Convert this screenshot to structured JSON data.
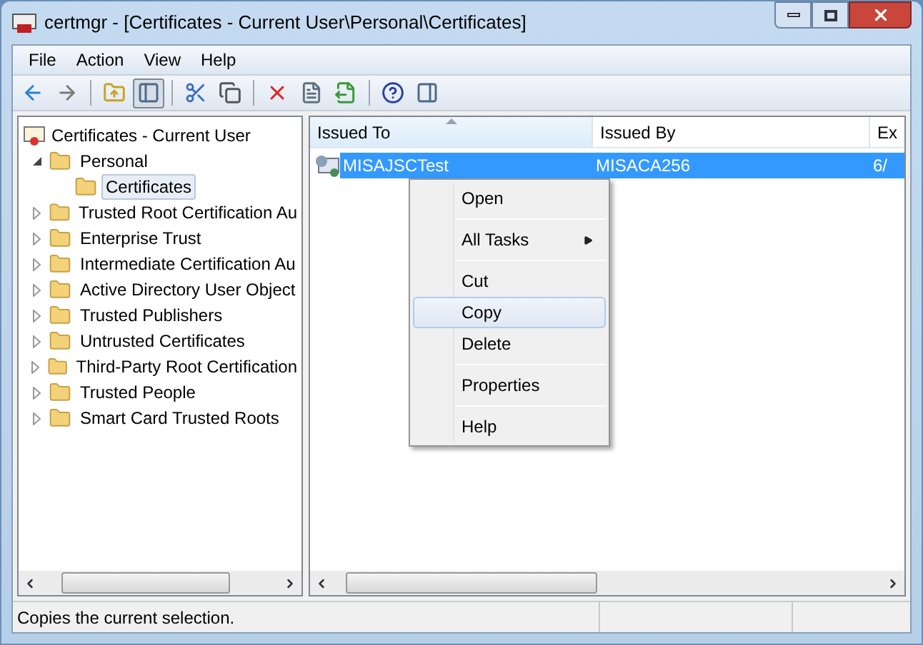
{
  "window": {
    "title": "certmgr - [Certificates - Current User\\Personal\\Certificates]"
  },
  "menu_bar": [
    "File",
    "Action",
    "View",
    "Help"
  ],
  "toolbar": [
    {
      "kind": "back",
      "pressed": false
    },
    {
      "kind": "forward",
      "pressed": false
    },
    {
      "kind": "separator"
    },
    {
      "kind": "up",
      "pressed": false
    },
    {
      "kind": "tree",
      "pressed": true
    },
    {
      "kind": "separator"
    },
    {
      "kind": "cut",
      "pressed": false
    },
    {
      "kind": "copy",
      "pressed": false
    },
    {
      "kind": "separator"
    },
    {
      "kind": "delete",
      "pressed": false
    },
    {
      "kind": "properties",
      "pressed": false
    },
    {
      "kind": "export",
      "pressed": false
    },
    {
      "kind": "separator"
    },
    {
      "kind": "help",
      "pressed": false
    },
    {
      "kind": "pane",
      "pressed": false
    }
  ],
  "tree": {
    "label": "Certificates - Current User",
    "children": [
      {
        "label": "Personal",
        "expanded": true,
        "selected": false,
        "children": [
          {
            "label": "Certificates",
            "selected": true
          }
        ]
      },
      {
        "label": "Trusted Root Certification Au",
        "expanded": false,
        "selected": false
      },
      {
        "label": "Enterprise Trust",
        "expanded": false,
        "selected": false
      },
      {
        "label": "Intermediate Certification Au",
        "expanded": false,
        "selected": false
      },
      {
        "label": "Active Directory User Object",
        "expanded": false,
        "selected": false
      },
      {
        "label": "Trusted Publishers",
        "expanded": false,
        "selected": false
      },
      {
        "label": "Untrusted Certificates",
        "expanded": false,
        "selected": false
      },
      {
        "label": "Third-Party Root Certification",
        "expanded": false,
        "selected": false
      },
      {
        "label": "Trusted People",
        "expanded": false,
        "selected": false
      },
      {
        "label": "Smart Card Trusted Roots",
        "expanded": false,
        "selected": false
      }
    ]
  },
  "table": {
    "columns": [
      "Issued To",
      "Issued By",
      "Ex"
    ],
    "rows": [
      {
        "cells": [
          "MISAJSCTest",
          "MISACA256",
          "6/"
        ],
        "selected": true
      }
    ]
  },
  "context_menu": [
    {
      "kind": "item",
      "label": "Open",
      "selected": false
    },
    {
      "kind": "separator"
    },
    {
      "kind": "item",
      "label": "All Tasks",
      "submenu": true,
      "selected": false
    },
    {
      "kind": "separator"
    },
    {
      "kind": "item",
      "label": "Cut",
      "selected": false
    },
    {
      "kind": "item",
      "label": "Copy",
      "selected": true
    },
    {
      "kind": "item",
      "label": "Delete",
      "selected": false
    },
    {
      "kind": "separator"
    },
    {
      "kind": "item",
      "label": "Properties",
      "selected": false
    },
    {
      "kind": "separator"
    },
    {
      "kind": "item",
      "label": "Help",
      "selected": false
    }
  ],
  "status_bar": "Copies the current selection."
}
